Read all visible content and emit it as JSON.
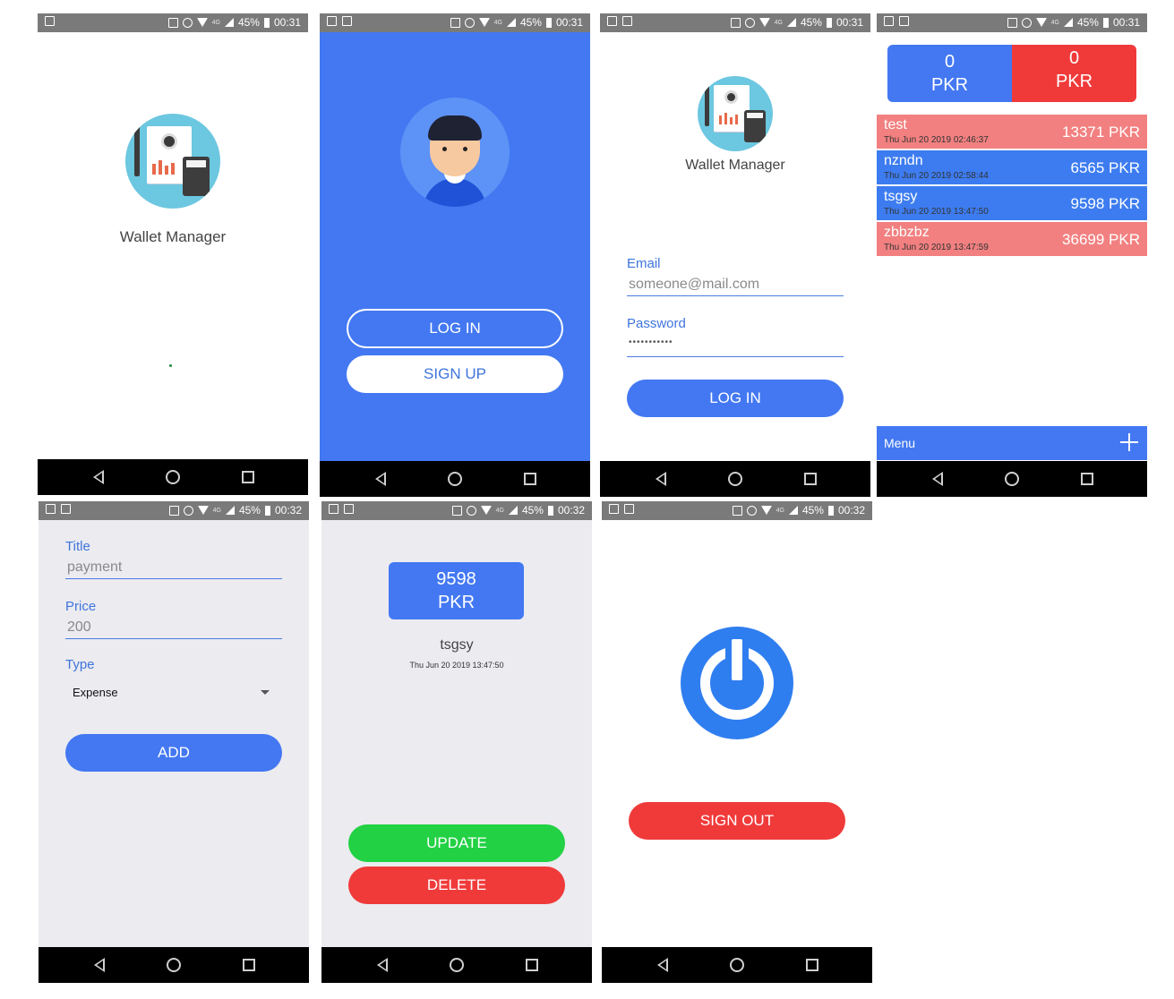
{
  "statusbar": {
    "battery": "45%",
    "time_0031": "00:31",
    "time_0032": "00:32",
    "net_small": "4G"
  },
  "splash": {
    "app_name": "Wallet Manager"
  },
  "welcome": {
    "login_label": "LOG IN",
    "signup_label": "SIGN UP"
  },
  "login": {
    "app_name": "Wallet Manager",
    "email_label": "Email",
    "email_placeholder": "someone@mail.com",
    "password_label": "Password",
    "password_value": "•••••••••••",
    "login_button": "LOG IN"
  },
  "dashboard": {
    "income_amount": "0",
    "income_currency": "PKR",
    "expense_amount": "0",
    "expense_currency": "PKR",
    "transactions": [
      {
        "title": "test",
        "date": "Thu Jun 20 2019 02:46:37",
        "amount": "13371 PKR",
        "color": "#f28080"
      },
      {
        "title": "nzndn",
        "date": "Thu Jun 20 2019 02:58:44",
        "amount": "6565 PKR",
        "color": "#3d7cf0"
      },
      {
        "title": "tsgsy",
        "date": "Thu Jun 20 2019 13:47:50",
        "amount": "9598 PKR",
        "color": "#3d7cf0"
      },
      {
        "title": "zbbzbz",
        "date": "Thu Jun 20 2019 13:47:59",
        "amount": "36699 PKR",
        "color": "#f28080"
      }
    ],
    "menu_label": "Menu",
    "add_icon": "plus-icon"
  },
  "add_form": {
    "title_label": "Title",
    "title_value": "payment",
    "price_label": "Price",
    "price_value": "200",
    "type_label": "Type",
    "type_value": "Expense",
    "add_button": "ADD"
  },
  "detail": {
    "amount": "9598",
    "currency": "PKR",
    "title": "tsgsy",
    "date": "Thu Jun 20 2019 13:47:50",
    "update_button": "UPDATE",
    "delete_button": "DELETE"
  },
  "signout": {
    "button": "SIGN OUT",
    "icon": "power-icon"
  },
  "colors": {
    "blue": "#4378f2",
    "red": "#f03a3a",
    "green": "#22d144",
    "salmon": "#f28080",
    "form_bg": "#ebebf0"
  }
}
